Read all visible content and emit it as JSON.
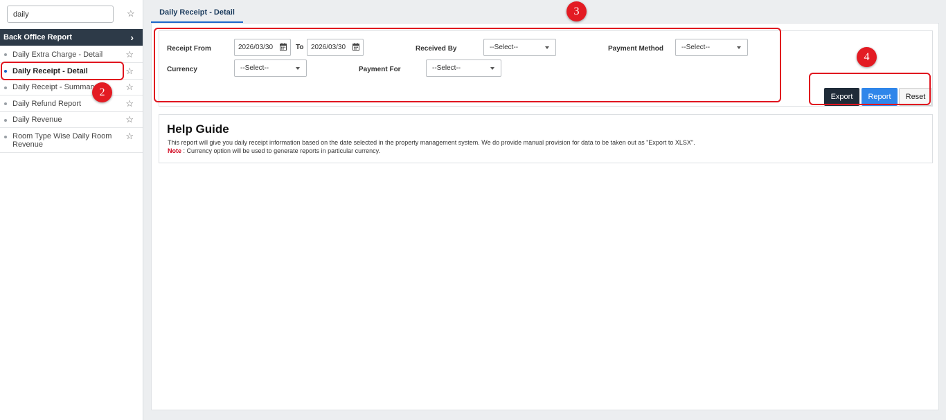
{
  "search": {
    "value": "daily"
  },
  "sidebar": {
    "section_title": "Back Office Report",
    "items": [
      {
        "label": "Daily Extra Charge - Detail"
      },
      {
        "label": "Daily Receipt - Detail",
        "active": true
      },
      {
        "label": "Daily Receipt - Summary"
      },
      {
        "label": "Daily Refund Report"
      },
      {
        "label": "Daily Revenue"
      },
      {
        "label": "Room Type Wise Daily Room Revenue"
      }
    ]
  },
  "tab": {
    "label": "Daily Receipt - Detail"
  },
  "filters": {
    "receipt_from_label": "Receipt From",
    "receipt_from_value": "2026/03/30",
    "to_label": "To",
    "to_value": "2026/03/30",
    "received_by_label": "Received By",
    "received_by_value": "--Select--",
    "payment_method_label": "Payment Method",
    "payment_method_value": "--Select--",
    "currency_label": "Currency",
    "currency_value": "--Select--",
    "payment_for_label": "Payment For",
    "payment_for_value": "--Select--"
  },
  "buttons": {
    "export": "Export",
    "report": "Report",
    "reset": "Reset"
  },
  "help": {
    "title": "Help Guide",
    "text": "This report will give you daily receipt information based on the date selected in the property management system. We do provide manual provision for data to be taken out as \"Export to XLSX\".",
    "note_label": "Note",
    "note_text": " : Currency option will be used to generate reports in particular currency."
  },
  "annotations": {
    "badge_2": "2",
    "badge_3": "3",
    "badge_4": "4"
  },
  "colors": {
    "accent": "#2f86ea",
    "header_dark": "#2d3a48",
    "annotation_red": "#e31b23"
  }
}
